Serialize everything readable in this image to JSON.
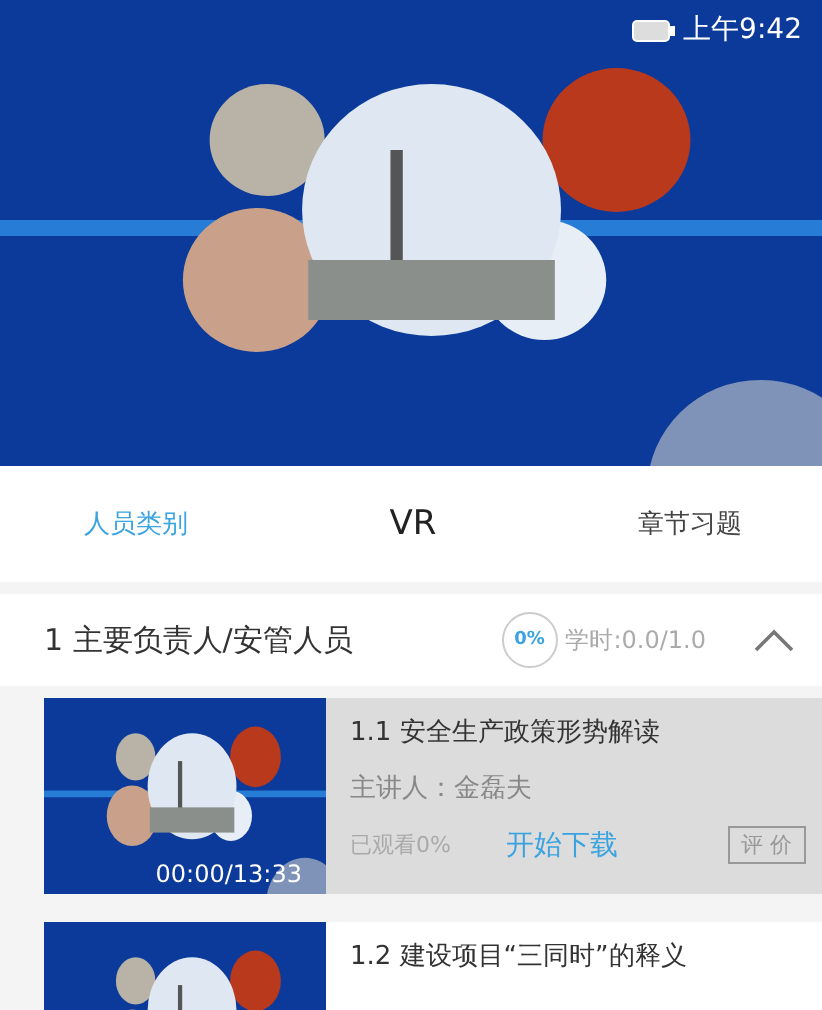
{
  "status_bar": {
    "time": "上午9:42"
  },
  "tabs": [
    {
      "label": "人员类别",
      "selected": true
    },
    {
      "label": "VR",
      "selected": false
    },
    {
      "label": "章节习题",
      "selected": false
    }
  ],
  "section": {
    "title": "1 主要负责人/安管人员",
    "progress": "0%",
    "hours": "学时:0.0/1.0",
    "expanded": true
  },
  "lessons": [
    {
      "selected": true,
      "duration": "00:00/13:33",
      "title": "1.1  安全生产政策形势解读",
      "lecturer": "主讲人：金磊夫",
      "watched": "已观看0%",
      "download": "开始下载",
      "rate": "评 价"
    },
    {
      "selected": false,
      "title": "1.2  建设项目“三同时”的释义"
    }
  ]
}
